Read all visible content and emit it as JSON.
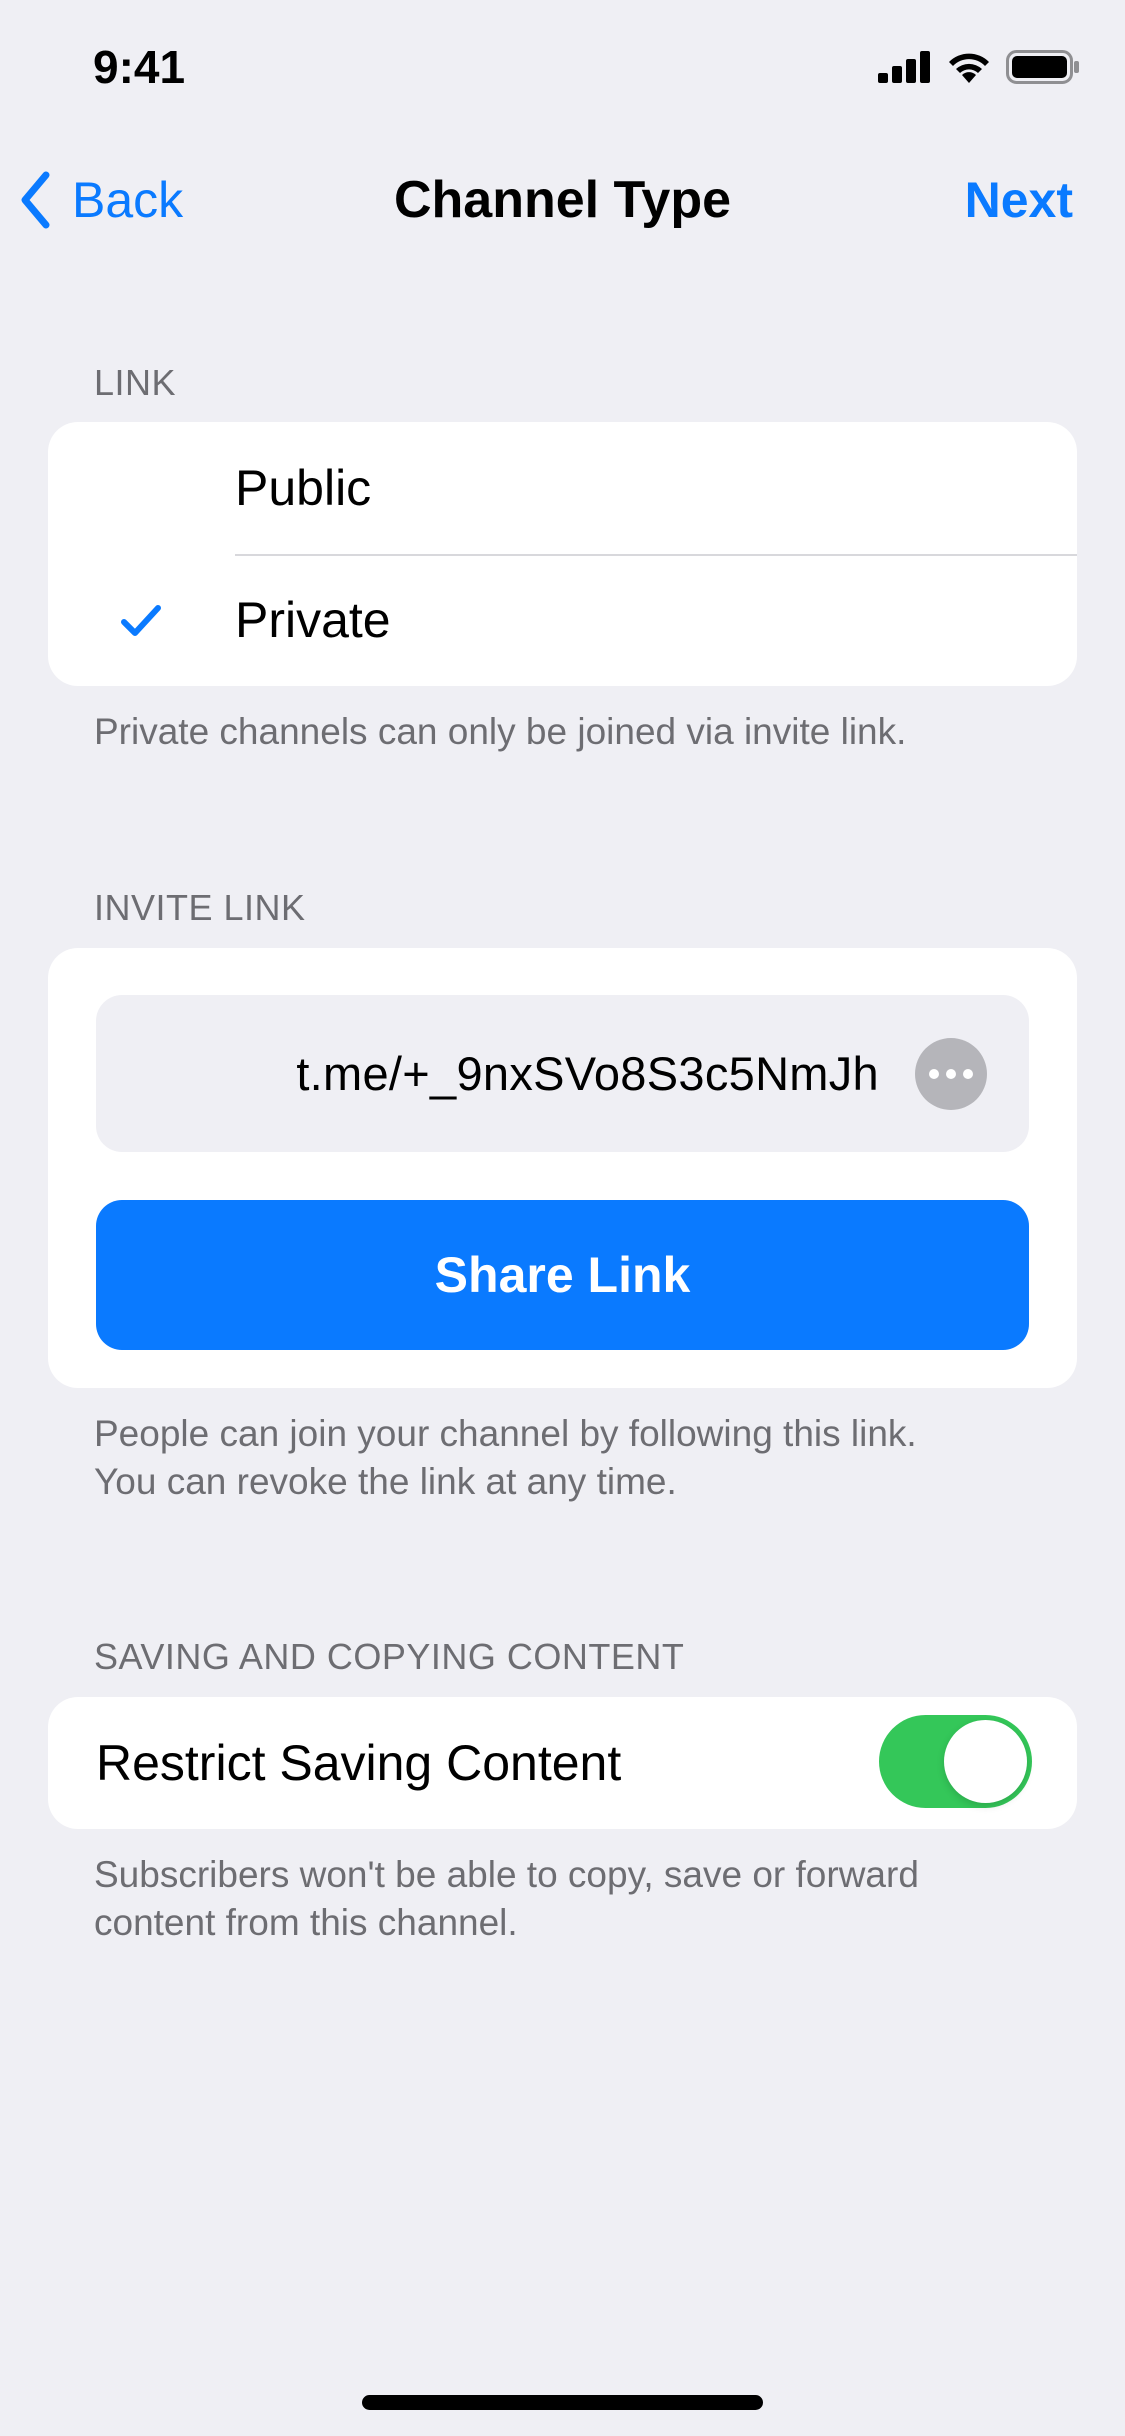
{
  "status_bar": {
    "time": "9:41",
    "icons": [
      "cellular-signal-icon",
      "wifi-icon",
      "battery-icon"
    ]
  },
  "nav": {
    "back_label": "Back",
    "title": "Channel Type",
    "next_label": "Next"
  },
  "link_section": {
    "header": "LINK",
    "options": [
      {
        "label": "Public",
        "selected": false
      },
      {
        "label": "Private",
        "selected": true
      }
    ],
    "footer": "Private channels can only be joined via invite link."
  },
  "invite_section": {
    "header": "INVITE LINK",
    "link_value": "t.me/+_9nxSVo8S3c5NmJh",
    "share_label": "Share Link",
    "footer_line1": "People can join your channel by following this link.",
    "footer_line2": "You can revoke the link at any time."
  },
  "content_section": {
    "header": "SAVING AND COPYING CONTENT",
    "toggle_label": "Restrict Saving Content",
    "toggle_on": true,
    "footer_line1": "Subscribers won't be able to copy, save or forward",
    "footer_line2": "content from this channel."
  },
  "colors": {
    "accent": "#0a7aff",
    "toggle_on": "#34c759",
    "background": "#efeff4",
    "secondary_text": "#6d6d72"
  }
}
